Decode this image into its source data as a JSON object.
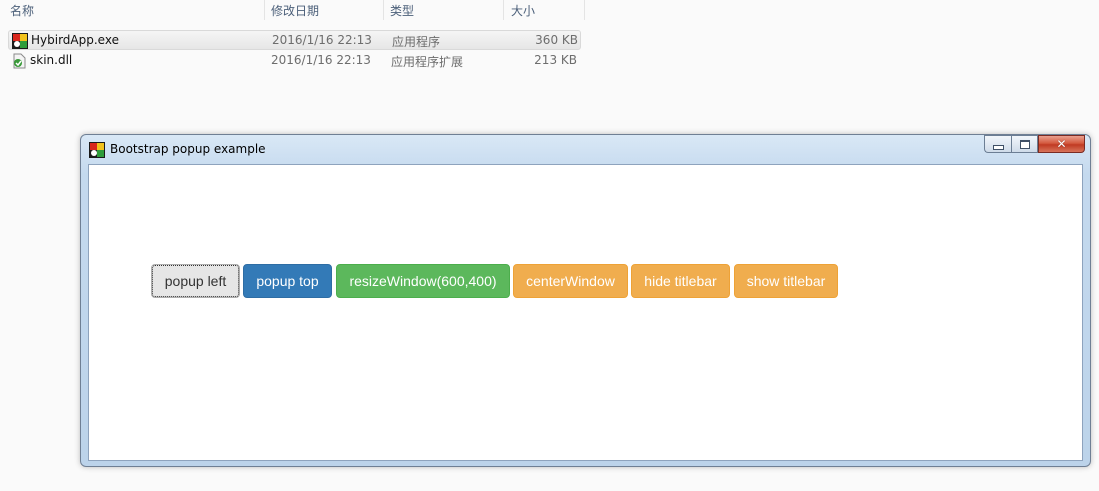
{
  "explorer": {
    "headers": {
      "name": "名称",
      "modified": "修改日期",
      "type": "类型",
      "size": "大小"
    },
    "files": [
      {
        "name": "HybirdApp.exe",
        "modified": "2016/1/16 22:13",
        "type": "应用程序",
        "size": "360 KB",
        "icon": "app-exe-icon"
      },
      {
        "name": "skin.dll",
        "modified": "2016/1/16 22:13",
        "type": "应用程序扩展",
        "size": "213 KB",
        "icon": "dll-file-icon"
      }
    ]
  },
  "window": {
    "title": "Bootstrap popup example",
    "icon": "app-icon",
    "caption": {
      "close_symbol": "✕"
    },
    "buttons": [
      {
        "label": "popup left",
        "style": "default"
      },
      {
        "label": "popup top",
        "style": "primary"
      },
      {
        "label": "resizeWindow(600,400)",
        "style": "success"
      },
      {
        "label": "centerWindow",
        "style": "warning"
      },
      {
        "label": "hide titlebar",
        "style": "warning"
      },
      {
        "label": "show titlebar",
        "style": "warning"
      }
    ]
  },
  "colors": {
    "primary": "#337ab7",
    "success": "#5cb85c",
    "warning": "#f0ad4e",
    "default": "#e6e6e6"
  }
}
